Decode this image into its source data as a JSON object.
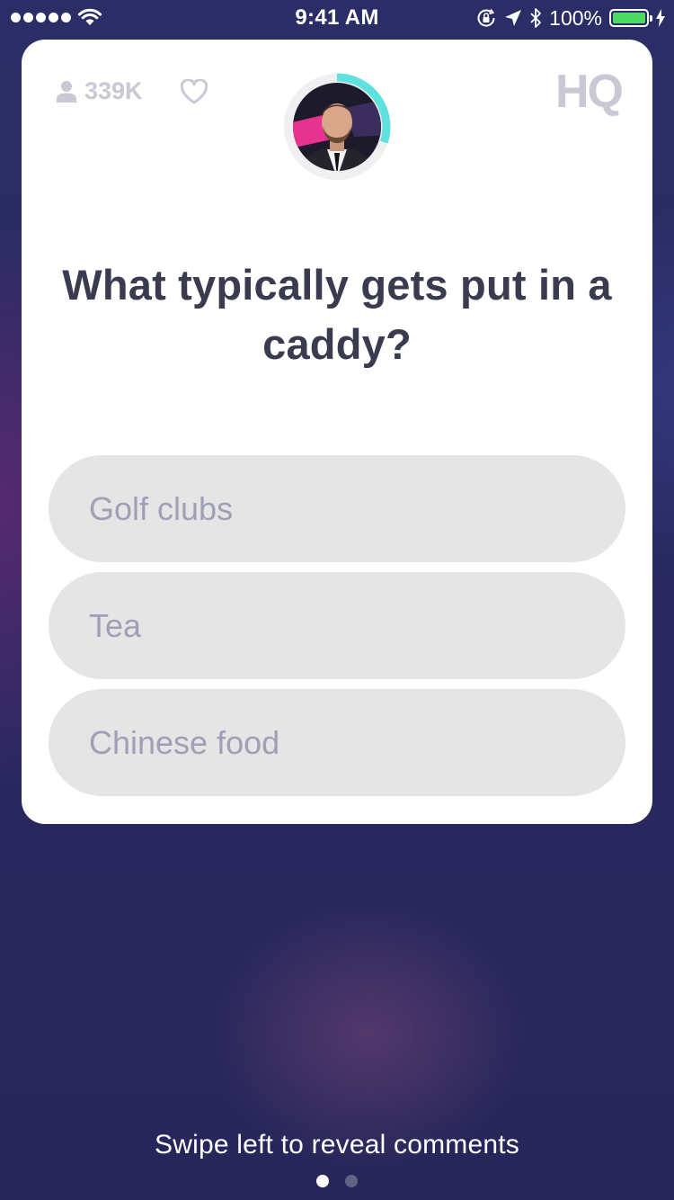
{
  "status_bar": {
    "time": "9:41 AM",
    "battery_percent": "100%",
    "battery_level": 1.0,
    "signal_bars": 5,
    "icons": [
      "signal-dots-icon",
      "wifi-icon",
      "orientation-lock-icon",
      "location-arrow-icon",
      "bluetooth-icon",
      "battery-icon",
      "charging-bolt-icon"
    ]
  },
  "card": {
    "viewer_count": "339K",
    "logo_text": "HQ",
    "question": "What typically gets put in a caddy?",
    "timer_progress": 0.3,
    "answers": [
      {
        "label": "Golf clubs"
      },
      {
        "label": "Tea"
      },
      {
        "label": "Chinese food"
      }
    ]
  },
  "footer": {
    "hint": "Swipe left to reveal comments",
    "page_count": 2,
    "active_page": 0
  },
  "colors": {
    "timer_accent": "#5ee1df",
    "answer_bg": "#e5e5e6",
    "answer_text": "#9f9fb6",
    "question_text": "#3a3b4f",
    "muted_icon": "#c9c9d6"
  }
}
